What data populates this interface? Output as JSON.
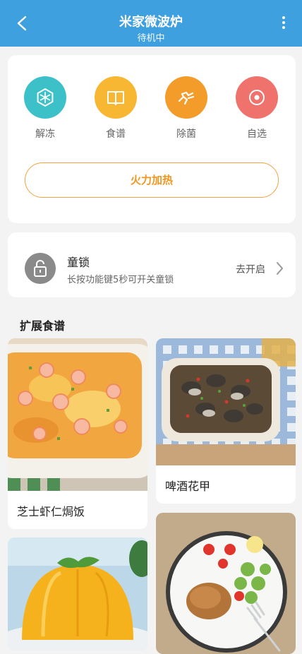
{
  "header": {
    "title": "米家微波炉",
    "status": "待机中"
  },
  "modes": [
    {
      "label": "解冻",
      "icon": "snowflake-hex-icon",
      "color": "#3cc1c8"
    },
    {
      "label": "食谱",
      "icon": "book-icon",
      "color": "#f7b733"
    },
    {
      "label": "除菌",
      "icon": "sterilize-icon",
      "color": "#f39c2a"
    },
    {
      "label": "自选",
      "icon": "custom-target-icon",
      "color": "#f0726c"
    }
  ],
  "heat_button": "火力加热",
  "child_lock": {
    "title": "童锁",
    "desc": "长按功能键5秒可开关童锁",
    "action": "去开启"
  },
  "recipes_section": {
    "title": "扩展食谱"
  },
  "recipes": [
    {
      "name": "芝士虾仁焗饭"
    },
    {
      "name": "啤酒花甲"
    },
    {
      "name": ""
    },
    {
      "name": ""
    }
  ]
}
